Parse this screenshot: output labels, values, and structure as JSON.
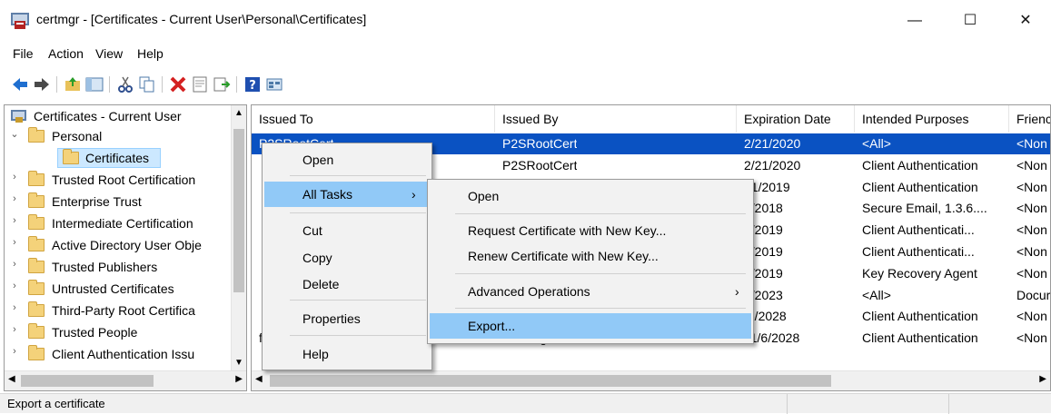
{
  "window": {
    "title": "certmgr - [Certificates - Current User\\Personal\\Certificates]",
    "minimize": "—",
    "maximize": "☐",
    "close": "✕"
  },
  "menubar": [
    "File",
    "Action",
    "View",
    "Help"
  ],
  "toolbar_icons": [
    "back-arrow-icon",
    "forward-arrow-icon",
    "up-folder-icon",
    "show-hide-tree-icon",
    "cut-icon",
    "copy-icon",
    "delete-icon",
    "properties-icon",
    "export-list-icon",
    "help-icon",
    "console-icon"
  ],
  "tree": {
    "root": "Certificates - Current User",
    "items": [
      {
        "label": "Personal",
        "expanded": true
      },
      {
        "label": "Certificates",
        "selected": true
      },
      {
        "label": "Trusted Root Certification"
      },
      {
        "label": "Enterprise Trust"
      },
      {
        "label": "Intermediate Certification"
      },
      {
        "label": "Active Directory User Obje"
      },
      {
        "label": "Trusted Publishers"
      },
      {
        "label": "Untrusted Certificates"
      },
      {
        "label": "Third-Party Root Certifica"
      },
      {
        "label": "Trusted People"
      },
      {
        "label": "Client Authentication Issu"
      }
    ]
  },
  "list": {
    "columns": [
      "Issued To",
      "Issued By",
      "Expiration Date",
      "Intended Purposes",
      "Frienc"
    ],
    "rows": [
      {
        "issued_to": "P2SRootCert",
        "issued_by": "P2SRootCert",
        "expires": "2/21/2020",
        "purposes": "<All>",
        "friendly": "<Non"
      },
      {
        "issued_to": "",
        "issued_by": "P2SRootCert",
        "expires": "2/21/2020",
        "purposes": "Client Authentication",
        "friendly": "<Non"
      },
      {
        "issued_to": "",
        "issued_by": "",
        "expires": "21/2019",
        "purposes": "Client Authentication",
        "friendly": "<Non"
      },
      {
        "issued_to": "",
        "issued_by": "",
        "expires": "2/2018",
        "purposes": "Secure Email, 1.3.6....",
        "friendly": "<Non"
      },
      {
        "issued_to": "",
        "issued_by": "",
        "expires": "6/2019",
        "purposes": "Client Authenticati...",
        "friendly": "<Non"
      },
      {
        "issued_to": "",
        "issued_by": "",
        "expires": "6/2019",
        "purposes": "Client Authenticati...",
        "friendly": "<Non"
      },
      {
        "issued_to": "",
        "issued_by": "",
        "expires": "6/2019",
        "purposes": "Key Recovery Agent",
        "friendly": "<Non"
      },
      {
        "issued_to": "",
        "issued_by": "",
        "expires": "6/2023",
        "purposes": "<All>",
        "friendly": "Docur"
      },
      {
        "issued_to": "",
        "issued_by": "",
        "expires": "/5/2028",
        "purposes": "Client Authentication",
        "friendly": "<Non"
      },
      {
        "issued_to": "f-7daf7...",
        "issued_by": "MS-Organization-Access",
        "expires": "11/6/2028",
        "purposes": "Client Authentication",
        "friendly": "<Non"
      }
    ]
  },
  "context_menu": {
    "items": [
      "Open",
      "All Tasks",
      "Cut",
      "Copy",
      "Delete",
      "Properties",
      "Help"
    ],
    "submenu_arrow": "›"
  },
  "submenu": {
    "items": [
      "Open",
      "Request Certificate with New Key...",
      "Renew Certificate with New Key...",
      "Advanced Operations",
      "Export..."
    ],
    "submenu_arrow": "›"
  },
  "status": {
    "text": "Export a certificate"
  },
  "colors": {
    "selection": "#0a52c2",
    "highlight": "#91c9f7",
    "menu_bg": "#f2f2f2"
  }
}
